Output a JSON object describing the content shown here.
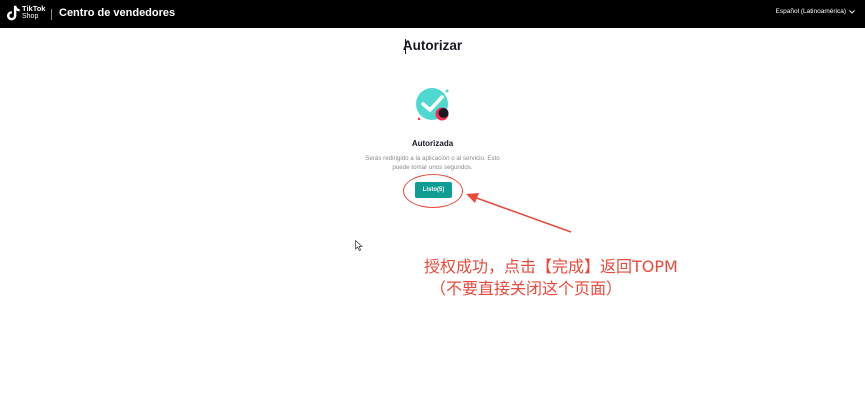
{
  "header": {
    "logo_line1": "TikTok",
    "logo_line2": "Shop",
    "title": "Centro de vendedores",
    "language": "Español (Latinoamérica)"
  },
  "main": {
    "page_title": "Autorizar",
    "status_title": "Autorizada",
    "description_line1": "Serás redirigido a la aplicación o al servicio. Esto",
    "description_line2": "puede tomar unos segundos.",
    "done_button": "Listo(5)"
  },
  "annotation": {
    "line1": "授权成功，点击【完成】返回TOPM",
    "line2": "（不要直接关闭这个页面）",
    "color": "#e84a3d"
  },
  "colors": {
    "topbar": "#000000",
    "accent": "#0f9c92",
    "check_circle": "#4fd8d0"
  }
}
